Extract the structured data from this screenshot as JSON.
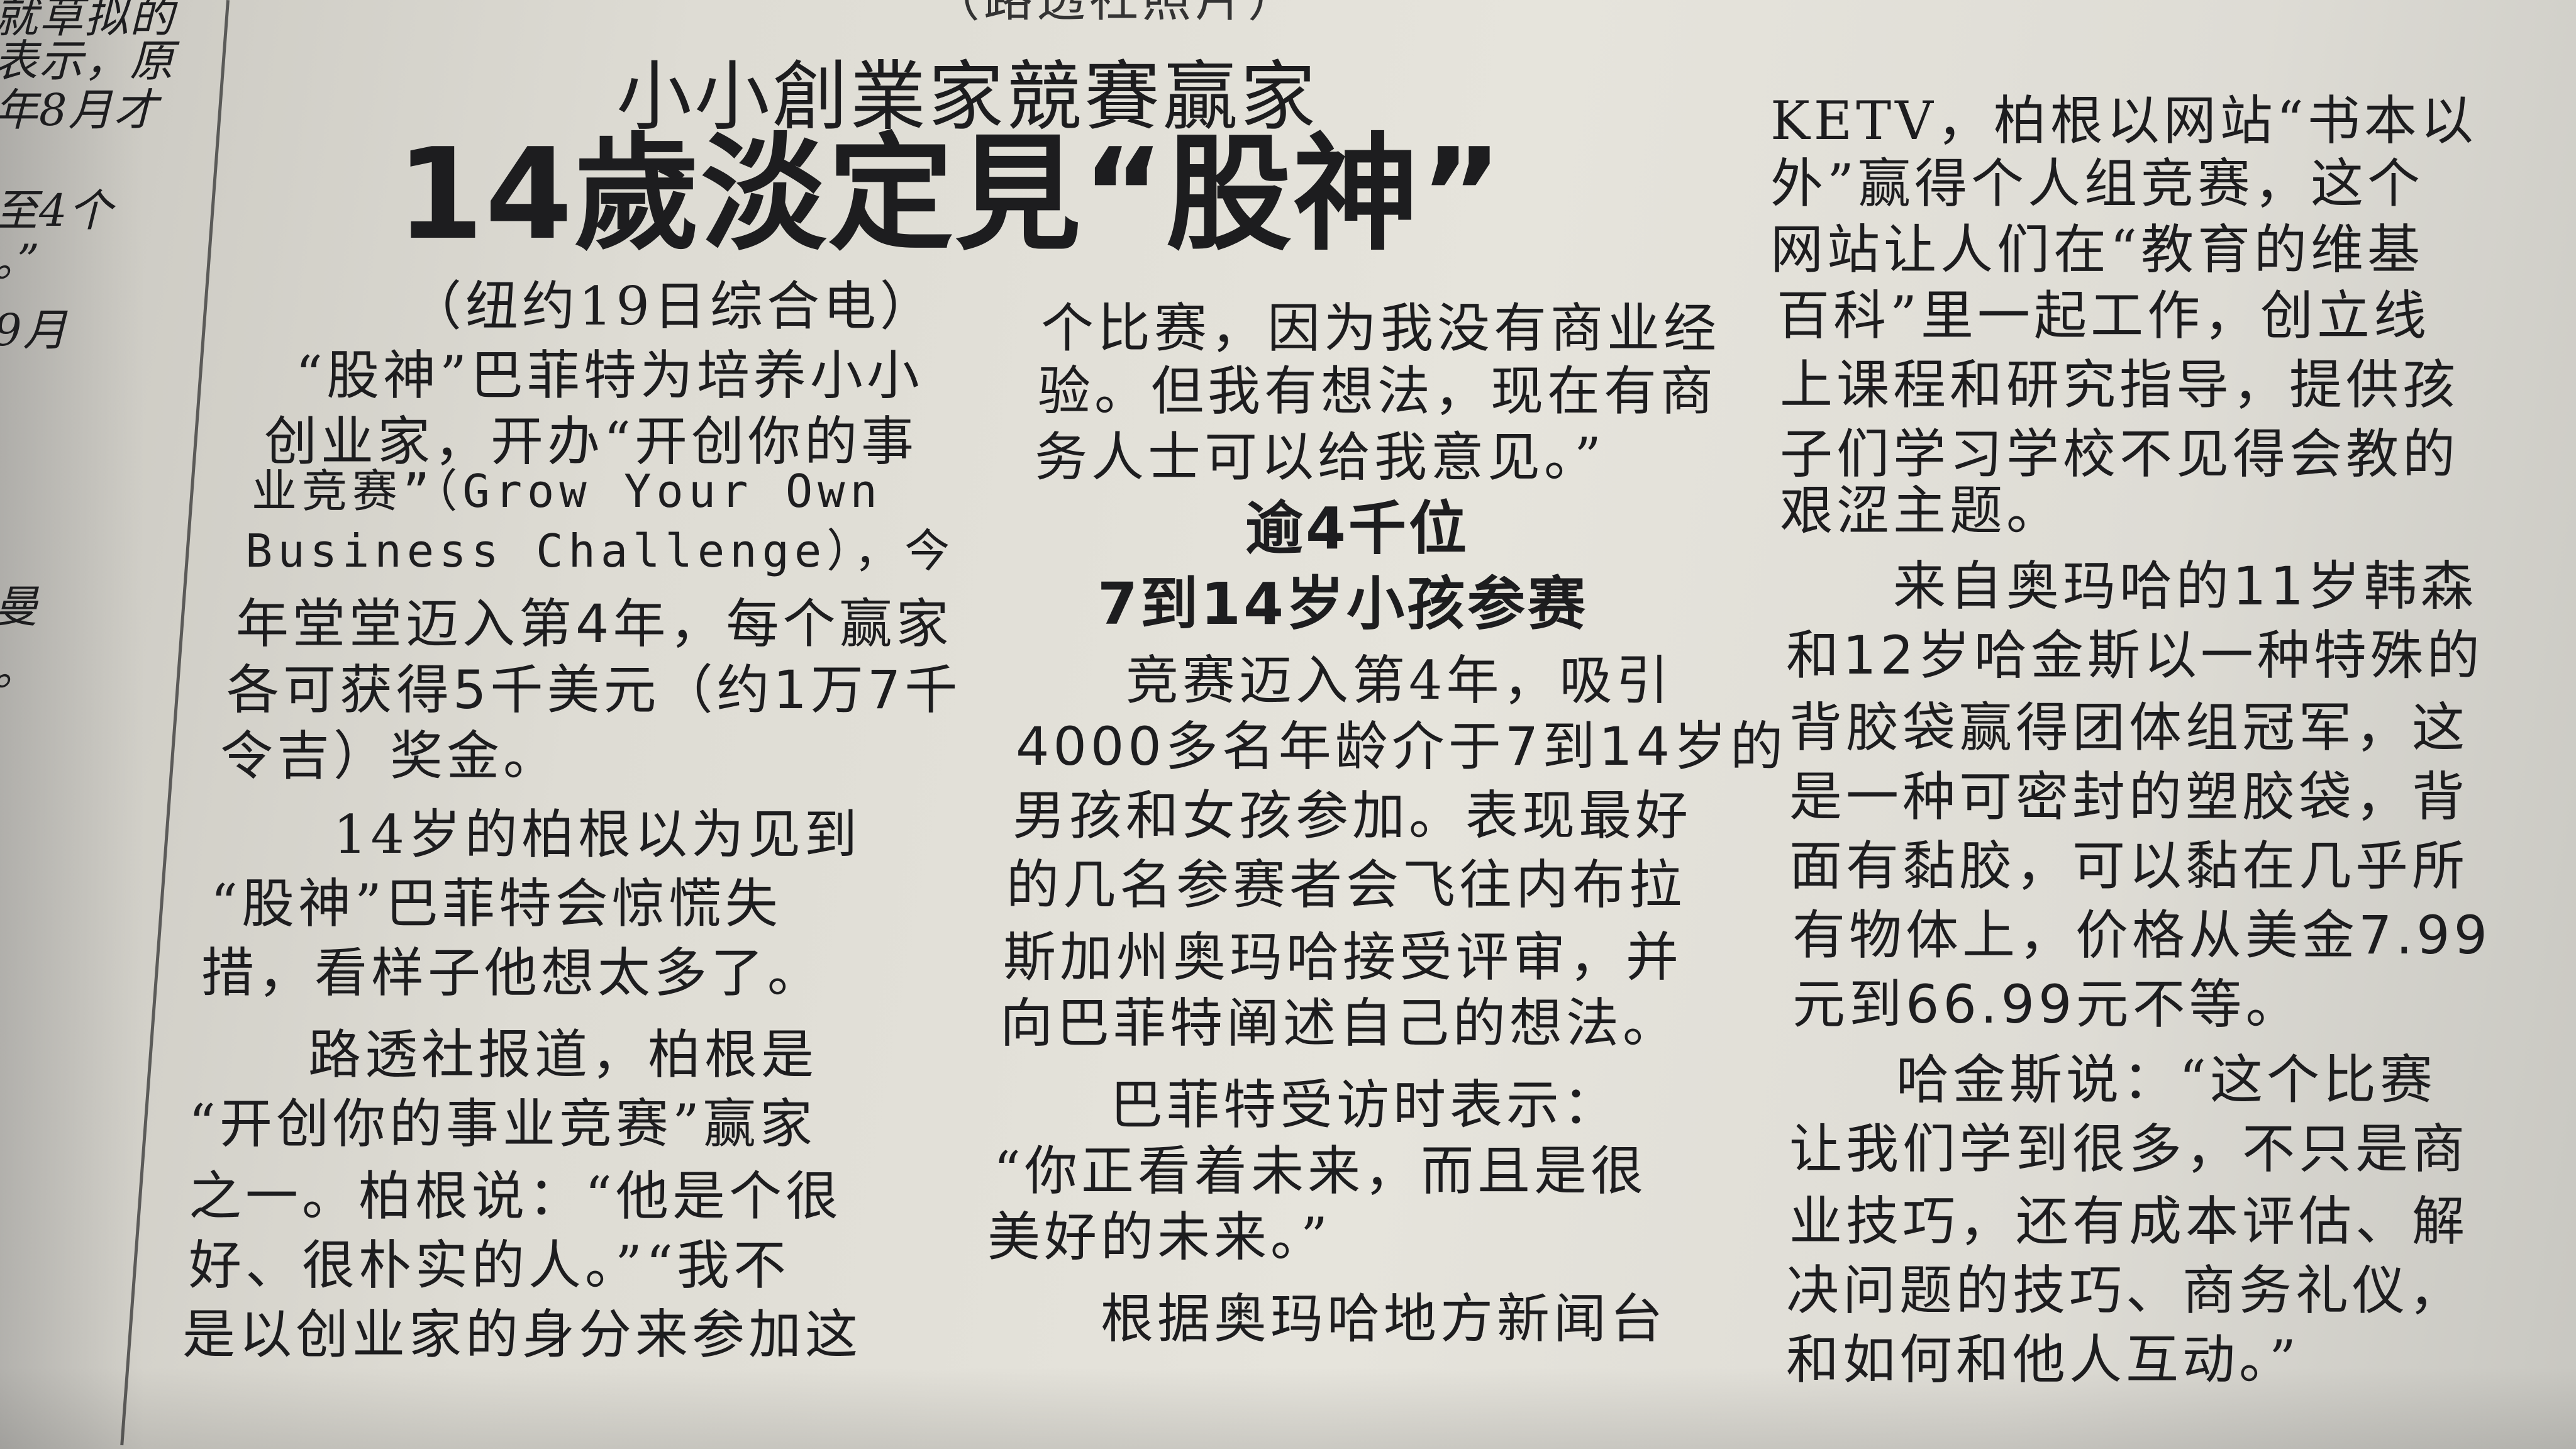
{
  "top_caption": "（路透社照片）",
  "left_fragments": [
    "就草拟的",
    "表示，原",
    "年8月才",
    "至4个",
    "。”",
    "9月",
    "曼",
    "。"
  ],
  "article": {
    "kicker": "小小創業家競賽贏家",
    "headline": "14歲淡定見“股神”",
    "col1": [
      "（纽约19日综合电）",
      "“股神”巴菲特为培养小小",
      "创业家，开办“开创你的事",
      "业竞赛”（Grow Your Own",
      "Business Challenge），今",
      "年堂堂迈入第4年，每个赢家",
      "各可获得5千美元（约1万7千",
      "令吉）奖金。",
      "14岁的柏根以为见到",
      "“股神”巴菲特会惊慌失",
      "措，看样子他想太多了。",
      "路透社报道，柏根是",
      "“开创你的事业竞赛”赢家",
      "之一。柏根说：“他是个很",
      "好、很朴实的人。”“我不",
      "是以创业家的身分来参加这"
    ],
    "col2_top": [
      "个比赛，因为我没有商业经",
      "验。但我有想法，现在有商",
      "务人士可以给我意见。”"
    ],
    "subhead": [
      "逾4千位",
      "7到14岁小孩参赛"
    ],
    "col2_bottom": [
      "竞赛迈入第4年，吸引",
      "4000多名年龄介于7到14岁的",
      "男孩和女孩参加。表现最好",
      "的几名参赛者会飞往内布拉",
      "斯加州奥玛哈接受评审，并",
      "向巴菲特阐述自己的想法。",
      "巴菲特受访时表示：",
      "“你正看着未来，而且是很",
      "美好的未来。”",
      "根据奥玛哈地方新闻台"
    ],
    "col3": [
      "KETV，柏根以网站“书本以",
      "外”赢得个人组竞赛，这个",
      "网站让人们在“教育的维基",
      "百科”里一起工作，创立线",
      "上课程和研究指导，提供孩",
      "子们学习学校不见得会教的",
      "艰涩主题。",
      "来自奥玛哈的11岁韩森",
      "和12岁哈金斯以一种特殊的",
      "背胶袋赢得团体组冠军，这",
      "是一种可密封的塑胶袋，背",
      "面有黏胶，可以黏在几乎所",
      "有物体上，价格从美金7.99",
      "元到66.99元不等。",
      "哈金斯说：“这个比赛",
      "让我们学到很多，不只是商",
      "业技巧，还有成本评估、解",
      "决问题的技巧、商务礼仪，",
      "和如何和他人互动。”"
    ]
  }
}
